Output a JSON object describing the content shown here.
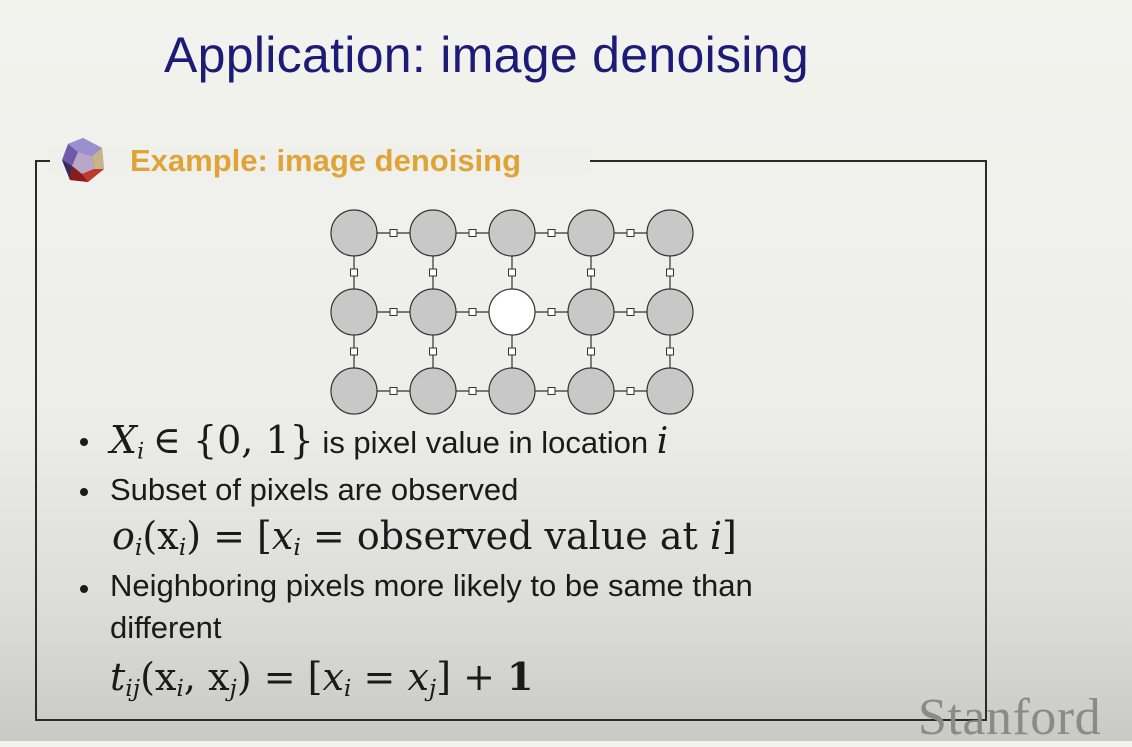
{
  "slide": {
    "title": "Application: image denoising",
    "example_title": "Example: image denoising",
    "watermark": "Stanford"
  },
  "bullets": [
    {
      "var": "X",
      "sub": "i",
      "set": "∈ {0, 1}",
      "text": " is pixel value in location ",
      "loc": "i"
    },
    {
      "text": "Subset of pixels are observed"
    },
    {
      "text_line1": "Neighboring pixels more likely to be same than",
      "text_line2": "different"
    }
  ],
  "equations": {
    "observation": {
      "lhs_fn": "o",
      "lhs_sub": "i",
      "lhs_arg": "(x",
      "lhs_arg_sub": "i",
      "lhs_close": ")",
      "eq": " = [",
      "rhs_var": "x",
      "rhs_sub": "i",
      "rhs_text": " = observed value at ",
      "rhs_i": "i",
      "close": "]"
    },
    "transition": {
      "fn": "t",
      "fn_sub": "ij",
      "open": "(x",
      "a_sub": "i",
      "comma": ", x",
      "b_sub": "j",
      "close": ")",
      "eq": " = [",
      "lhs_x": "x",
      "lhs_sub": "i",
      "mid": " = ",
      "rhs_x": "x",
      "rhs_sub": "j",
      "tail": "] + ",
      "plus": "1"
    }
  },
  "grid": {
    "rows": 3,
    "cols": 5,
    "unobserved": [
      [
        1,
        2
      ]
    ]
  },
  "colors": {
    "title": "#1c1c78",
    "example_title": "#e0a436",
    "node_fill": "#c8c8c8",
    "node_empty": "#ffffff"
  }
}
